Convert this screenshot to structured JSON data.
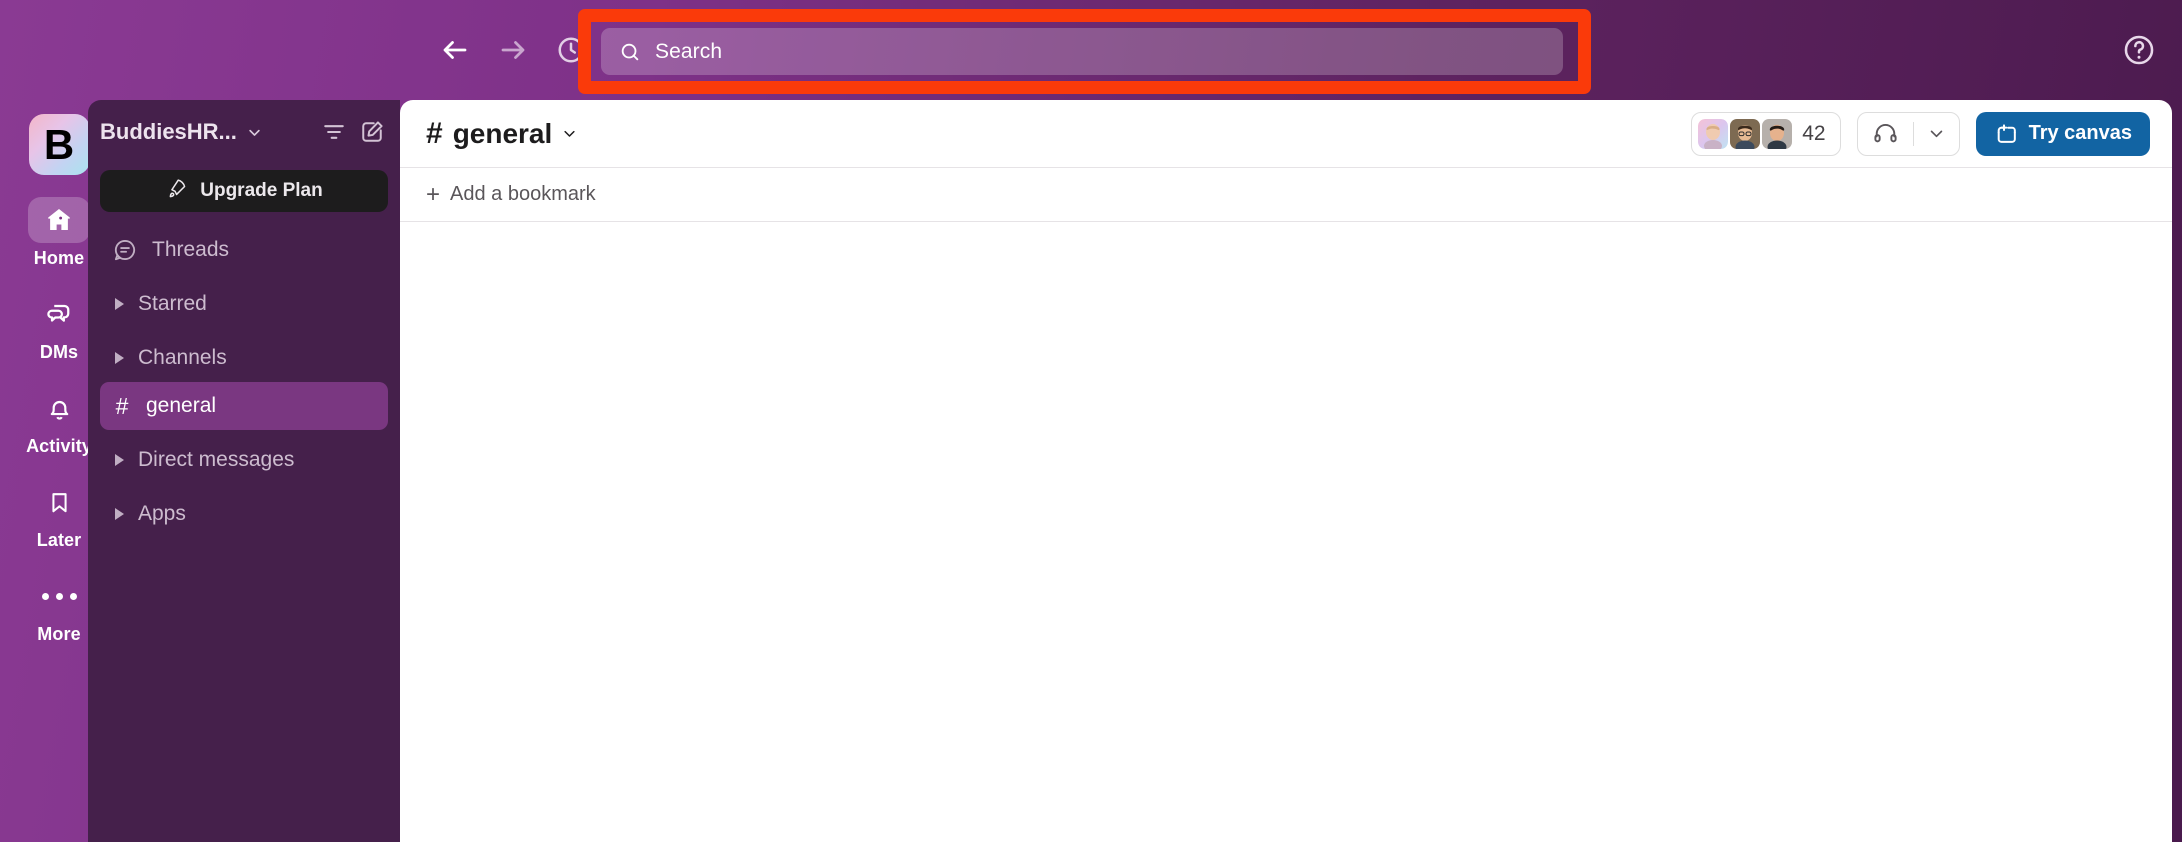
{
  "colors": {
    "topbar_left": "#8A3A93",
    "topbar_right": "#4A1A4D",
    "sidebar_bg": "#45204B",
    "selected_channel": "#7A3781",
    "highlight_red": "#FA3A0A",
    "canvas_blue": "#1264A3",
    "upgrade_black": "#1D1C1D"
  },
  "topbar": {
    "back_icon": "arrow-left-icon",
    "forward_icon": "arrow-right-icon",
    "history_icon": "clock-history-icon",
    "help_icon": "question-circle-icon"
  },
  "search": {
    "placeholder": "Search",
    "value": "",
    "icon": "search-icon",
    "highlighted": true
  },
  "rail": {
    "workspace_initial": "B",
    "items": [
      {
        "label": "Home",
        "icon": "home-icon",
        "active": true
      },
      {
        "label": "DMs",
        "icon": "dms-icon",
        "active": false
      },
      {
        "label": "Activity",
        "icon": "bell-icon",
        "active": false
      },
      {
        "label": "Later",
        "icon": "bookmark-icon",
        "active": false
      },
      {
        "label": "More",
        "icon": "ellipsis-icon",
        "active": false
      }
    ]
  },
  "sidebar": {
    "workspace_name": "BuddiesHR...",
    "workspace_chevron": "chevron-down-icon",
    "filter_icon": "filter-icon",
    "compose_icon": "compose-icon",
    "upgrade": {
      "label": "Upgrade Plan",
      "icon": "rocket-icon"
    },
    "threads": {
      "label": "Threads",
      "icon": "threads-icon"
    },
    "sections": [
      {
        "label": "Starred",
        "type": "section",
        "expanded": false
      },
      {
        "label": "Channels",
        "type": "section",
        "expanded": false
      },
      {
        "label": "general",
        "type": "channel",
        "prefix": "#",
        "selected": true
      },
      {
        "label": "Direct messages",
        "type": "section",
        "expanded": false
      },
      {
        "label": "Apps",
        "type": "section",
        "expanded": false
      }
    ]
  },
  "channel": {
    "hash": "#",
    "name": "general",
    "chevron": "chevron-down-icon",
    "member_count": "42",
    "members_icon": "avatar-stack",
    "huddle_icon": "headphones-icon",
    "huddle_chevron": "chevron-down-icon",
    "canvas_button": {
      "label": "Try canvas",
      "icon": "canvas-plus-icon"
    },
    "bookmark_bar": {
      "label": "Add a bookmark",
      "icon": "plus-icon"
    }
  }
}
